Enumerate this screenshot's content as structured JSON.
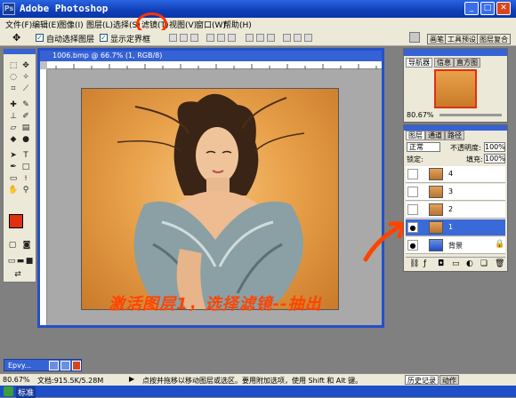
{
  "window": {
    "title": "Adobe Photoshop"
  },
  "menu": [
    "文件(F)",
    "编辑(E)",
    "图像(I)",
    "图层(L)",
    "选择(S)",
    "滤镜(T)",
    "视图(V)",
    "窗口(W)",
    "帮助(H)"
  ],
  "options": {
    "auto_select": "自动选择图层",
    "show_bounds": "显示定界框"
  },
  "palette_well": [
    "画笔",
    "工具预设",
    "图层复合"
  ],
  "document": {
    "title": "1006.bmp @ 66.7% (1, RGB/8)"
  },
  "annotation": "激活图层1，选择滤镜--抽出",
  "navigator": {
    "tabs": [
      "导航器",
      "信息",
      "直方图"
    ],
    "zoom": "80.67%"
  },
  "layers": {
    "tabs": [
      "图层",
      "通道",
      "路径"
    ],
    "blend_mode": "正常",
    "opacity_label": "不透明度:",
    "opacity": "100%",
    "lock_label": "锁定:",
    "fill_label": "填充:",
    "fill": "100%",
    "items": [
      {
        "name": "4"
      },
      {
        "name": "3"
      },
      {
        "name": "2"
      },
      {
        "name": "1"
      },
      {
        "name": "背景"
      }
    ]
  },
  "status": {
    "zoom": "80.67%",
    "doc_size": "文档:915.5K/5.28M",
    "hint": "点按并拖移以移动图层或选区。要用附加选项，使用 Shift 和 Alt 键。"
  },
  "minimized": {
    "label": "Epvy..."
  },
  "bottom_tabs": [
    "历史记录",
    "动作"
  ],
  "taskbar": {
    "label": "标准"
  },
  "colors": {
    "accent": "#2450c8",
    "annotation": "#ff4400",
    "foreground": "#e03010"
  }
}
